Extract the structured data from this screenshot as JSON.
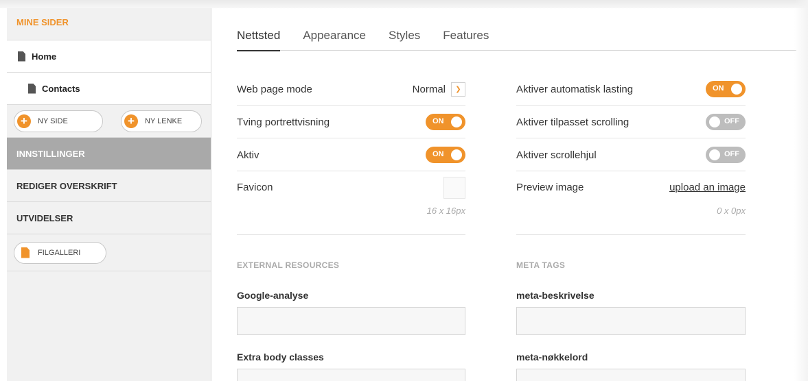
{
  "sidebar": {
    "header": "MINE SIDER",
    "pages": [
      {
        "label": "Home",
        "level": 0
      },
      {
        "label": "Contacts",
        "level": 1
      }
    ],
    "new_page_label": "NY SIDE",
    "new_link_label": "NY LENKE",
    "sections": [
      "INNSTILLINGER",
      "REDIGER OVERSKRIFT",
      "UTVIDELSER"
    ],
    "active_section": "INNSTILLINGER",
    "file_gallery_label": "FILGALLERI"
  },
  "tabs": [
    {
      "label": "Nettsted",
      "active": true
    },
    {
      "label": "Appearance",
      "active": false
    },
    {
      "label": "Styles",
      "active": false
    },
    {
      "label": "Features",
      "active": false
    }
  ],
  "left_settings": {
    "web_page_mode": {
      "label": "Web page mode",
      "value": "Normal"
    },
    "force_portrait": {
      "label": "Tving portrettvisning",
      "state": "ON"
    },
    "active": {
      "label": "Aktiv",
      "state": "ON"
    },
    "favicon": {
      "label": "Favicon",
      "size_note": "16 x 16px"
    }
  },
  "right_settings": {
    "auto_loading": {
      "label": "Aktiver automatisk lasting",
      "state": "ON"
    },
    "custom_scrolling": {
      "label": "Aktiver tilpasset scrolling",
      "state": "OFF"
    },
    "scroll_wheel": {
      "label": "Aktiver scrollehjul",
      "state": "OFF"
    },
    "preview_image": {
      "label": "Preview image",
      "link": "upload an image",
      "size_note": "0 x 0px"
    }
  },
  "external_resources": {
    "title": "EXTERNAL RESOURCES",
    "google_analytics_label": "Google-analyse",
    "google_analytics_value": "",
    "extra_body_classes_label": "Extra body classes",
    "extra_body_classes_value": ""
  },
  "meta_tags": {
    "title": "META TAGS",
    "description_label": "meta-beskrivelse",
    "description_value": "",
    "keywords_label": "meta-nøkkelord",
    "keywords_value": ""
  },
  "colors": {
    "accent": "#f0932b",
    "active_section_bg": "#a9a9a9",
    "toggle_off": "#bdbdbd"
  }
}
